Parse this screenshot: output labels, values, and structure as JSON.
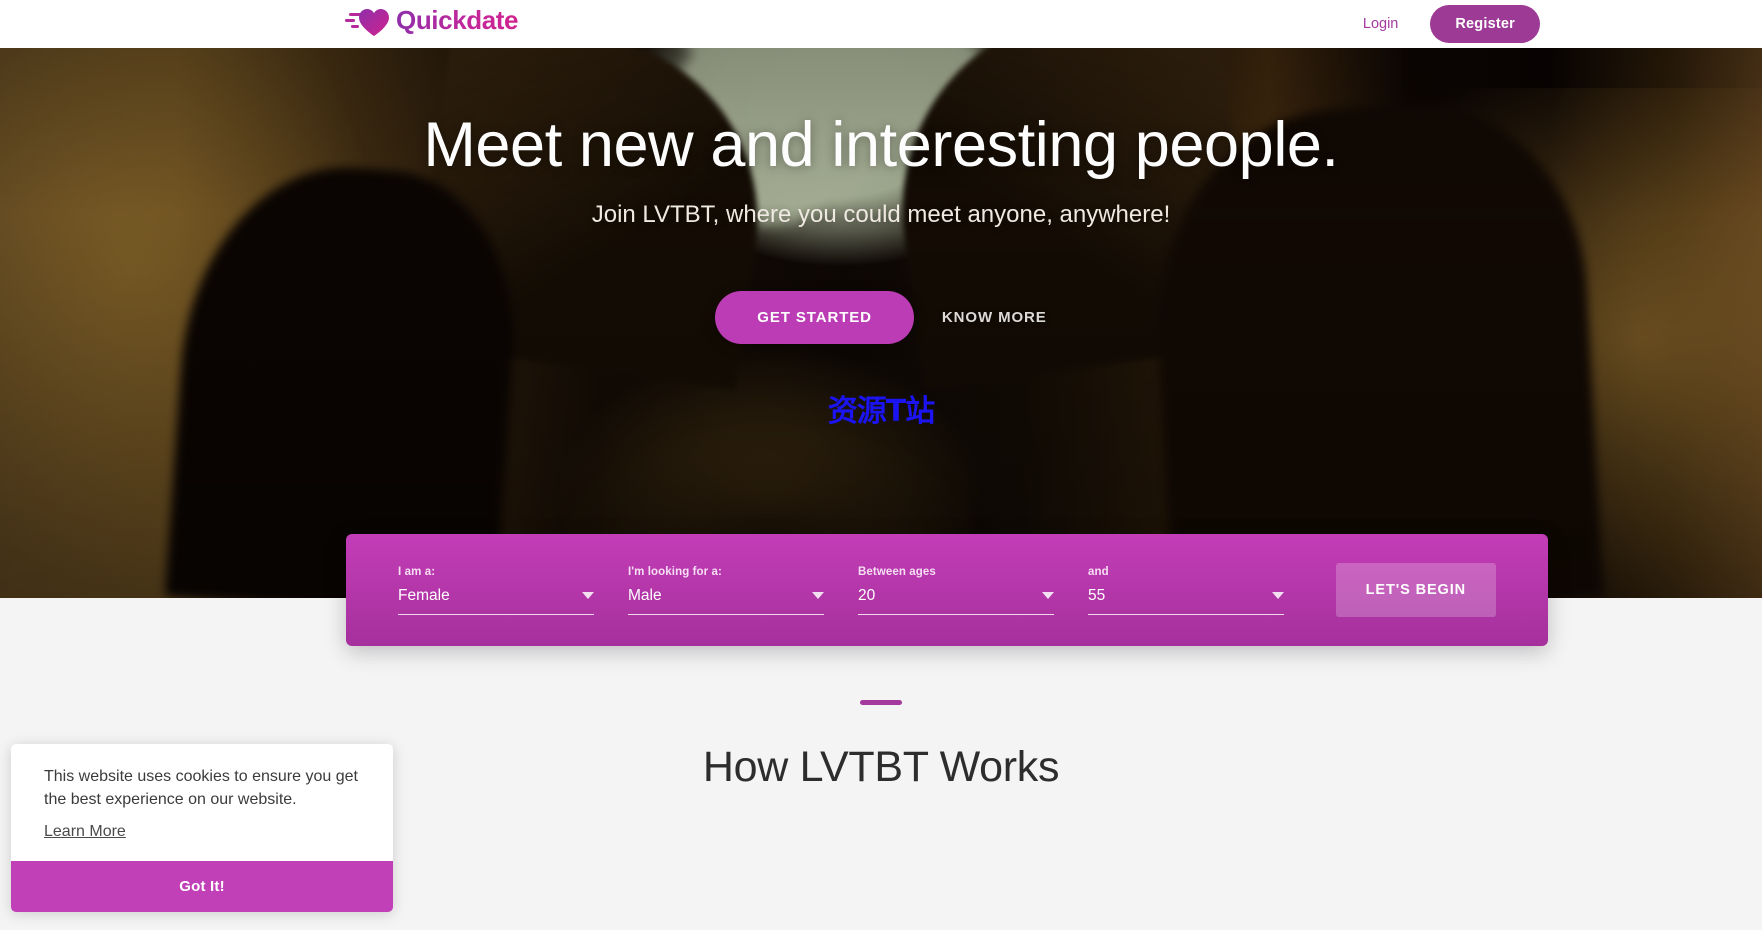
{
  "header": {
    "brand": "Quickdate",
    "login_label": "Login",
    "register_label": "Register"
  },
  "hero": {
    "title": "Meet new and interesting people.",
    "subtitle": "Join LVTBT, where you could meet anyone, anywhere!",
    "primary_cta": "GET STARTED",
    "secondary_cta": "KNOW MORE",
    "watermark": "资源T站"
  },
  "search_bar": {
    "fields": [
      {
        "label": "I am a:",
        "value": "Female"
      },
      {
        "label": "I'm looking for a:",
        "value": "Male"
      },
      {
        "label": "Between ages",
        "value": "20"
      },
      {
        "label": "and",
        "value": "55"
      }
    ],
    "submit_label": "LET'S BEGIN"
  },
  "how_section": {
    "title": "How LVTBT Works"
  },
  "cookie_banner": {
    "message": "This website uses cookies to ensure you get the best experience on our website.",
    "learn_more_label": "Learn More",
    "accept_label": "Got It!"
  },
  "colors": {
    "brand_purple": "#9c3a95",
    "magenta": "#c33db7",
    "accent_pill": "#bb3cb4",
    "cookie_accept": "#c140b8",
    "watermark_blue": "#1b14f0",
    "page_bg": "#f4f4f5"
  }
}
